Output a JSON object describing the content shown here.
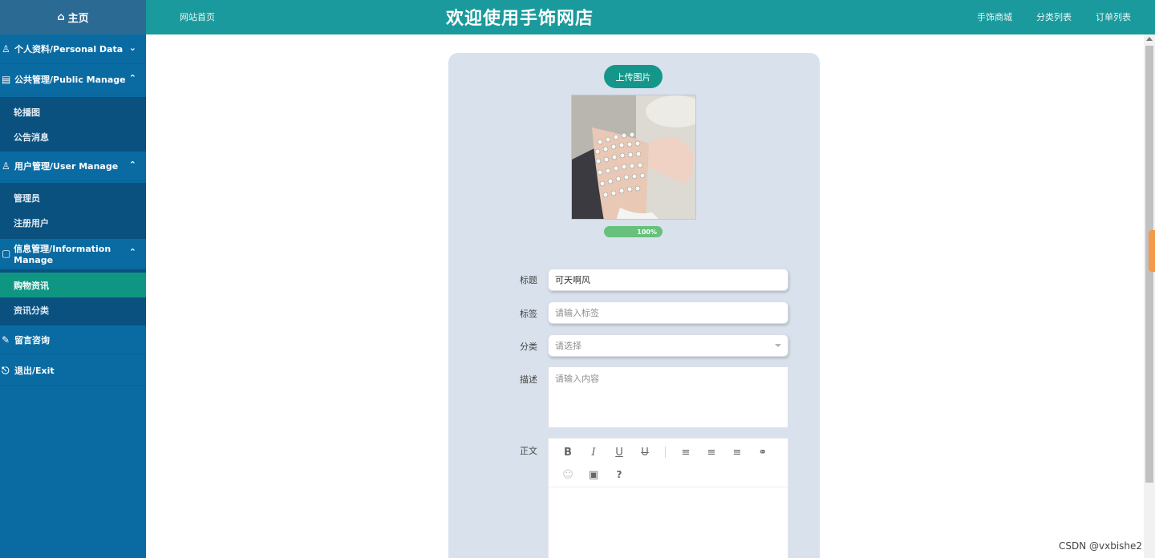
{
  "header": {
    "home_label": "主页",
    "site_home_link": "网站首页",
    "title": "欢迎使用手饰网店",
    "links": [
      "手饰商城",
      "分类列表",
      "订单列表"
    ]
  },
  "sidebar": {
    "groups": [
      {
        "label": "个人资料/Personal Data",
        "icon": "user-icon",
        "expanded": false
      },
      {
        "label": "公共管理/Public Manage",
        "icon": "board-icon",
        "expanded": true,
        "items": [
          "轮播图",
          "公告消息"
        ]
      },
      {
        "label": "用户管理/User Manage",
        "icon": "user-icon",
        "expanded": true,
        "items": [
          "管理员",
          "注册用户"
        ]
      },
      {
        "label": "信息管理/Information Manage",
        "icon": "info-icon",
        "expanded": true,
        "items": [
          "购物资讯",
          "资讯分类"
        ],
        "active_item": "购物资讯"
      },
      {
        "label": "留言咨询",
        "icon": "message-icon",
        "expanded": false
      },
      {
        "label": "退出/Exit",
        "icon": "exit-icon",
        "expanded": false
      }
    ]
  },
  "form": {
    "upload_label": "上传图片",
    "progress_label": "100%",
    "progress_value": 100,
    "fields": {
      "title_label": "标题",
      "title_value": "可天啊风",
      "tags_label": "标签",
      "tags_placeholder": "请输入标签",
      "category_label": "分类",
      "category_placeholder": "请选择",
      "desc_label": "描述",
      "desc_placeholder": "请输入内容",
      "body_label": "正文"
    },
    "editor_toolbar": [
      "bold",
      "italic",
      "underline",
      "strikethrough",
      "align-left",
      "align-center",
      "align-right",
      "link",
      "emoji",
      "image",
      "help"
    ]
  },
  "watermark": "CSDN @vxbishe2",
  "colors": {
    "topbar": "#1a9a9c",
    "sidebar": "#0a6ba3",
    "submenu": "#0a5180",
    "active": "#0f9683",
    "card": "#d9e1ec"
  }
}
